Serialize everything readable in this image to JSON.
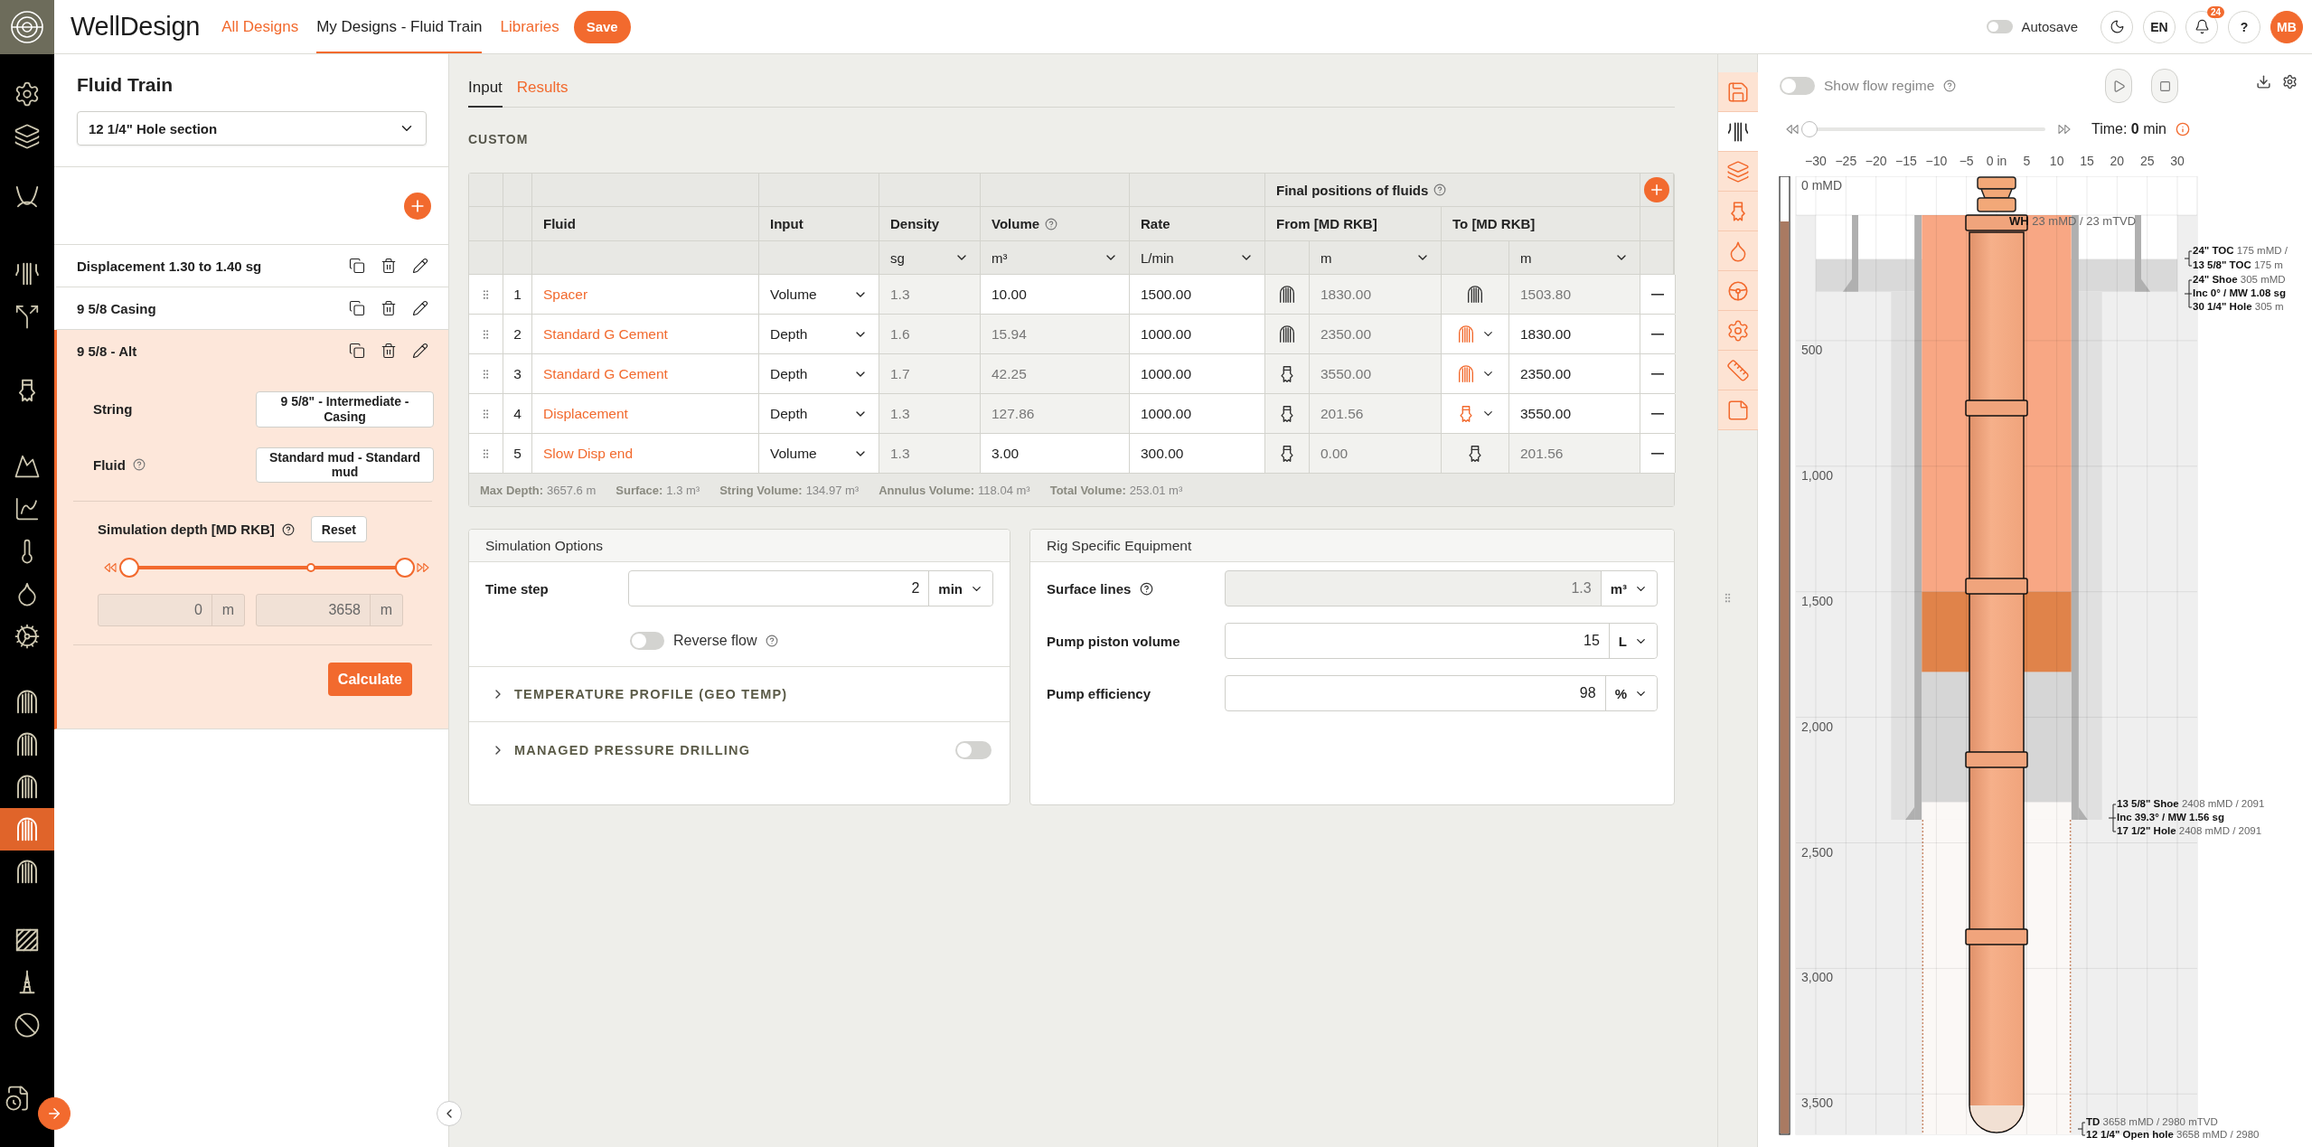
{
  "topbar": {
    "brand": "WellDesign",
    "nav": [
      {
        "label": "All Designs",
        "selected": false
      },
      {
        "label": "My Designs - Fluid Train",
        "selected": true
      },
      {
        "label": "Libraries",
        "selected": false
      }
    ],
    "save": "Save",
    "autosave": {
      "label": "Autosave",
      "on": false
    },
    "language": "EN",
    "notifications": "24",
    "help": "?",
    "avatar": "MB"
  },
  "rail": {
    "groups": [
      {
        "items": [
          {
            "kind": "gear",
            "selected": false
          },
          {
            "kind": "strata",
            "selected": false
          }
        ]
      },
      {
        "items": [
          {
            "kind": "curve",
            "selected": false
          }
        ]
      },
      {
        "items": [
          {
            "kind": "pipes",
            "selected": false
          },
          {
            "kind": "split",
            "selected": false
          }
        ]
      },
      {
        "items": [
          {
            "kind": "bit",
            "selected": false
          }
        ]
      },
      {
        "items": [
          {
            "kind": "mountains",
            "selected": false
          },
          {
            "kind": "chart",
            "selected": false
          },
          {
            "kind": "thermometer",
            "selected": false
          },
          {
            "kind": "droplet",
            "selected": false
          },
          {
            "kind": "gear-play",
            "selected": false
          }
        ]
      },
      {
        "items": [
          {
            "kind": "casing",
            "selected": false
          },
          {
            "kind": "casing",
            "selected": false
          },
          {
            "kind": "casing",
            "selected": false
          },
          {
            "kind": "casing",
            "selected": true
          },
          {
            "kind": "casing",
            "selected": false
          }
        ]
      },
      {
        "items": [
          {
            "kind": "hatch",
            "selected": false
          },
          {
            "kind": "tower",
            "selected": false
          },
          {
            "kind": "ban",
            "selected": false
          }
        ]
      },
      {
        "items": [
          {
            "kind": "file-clock",
            "selected": false
          }
        ]
      }
    ]
  },
  "sidebar": {
    "title": "Fluid Train",
    "section": "12 1/4\" Hole section",
    "trains": [
      {
        "name": "Displacement 1.30 to 1.40 sg",
        "selected": false
      },
      {
        "name": "9 5/8 Casing",
        "selected": false
      },
      {
        "name": "9 5/8 - Alt",
        "selected": true,
        "details": {
          "string_label": "String",
          "string_value": "9 5/8\" - Intermediate - Casing",
          "fluid_label": "Fluid",
          "fluid_value": "Standard mud - Standard mud",
          "depth_label": "Simulation depth [MD RKB]",
          "reset": "Reset",
          "range": {
            "start": {
              "level": 0
            },
            "marker": {
              "level": 0.66
            },
            "end": {
              "level": 1
            }
          },
          "from": {
            "value": "0",
            "unit": "m"
          },
          "to": {
            "value": "3658",
            "unit": "m"
          },
          "calculate": "Calculate"
        }
      }
    ]
  },
  "main": {
    "tabs": [
      {
        "label": "Input",
        "selected": true
      },
      {
        "label": "Results",
        "selected": false
      }
    ],
    "section": "CUSTOM",
    "table": {
      "group_header": "Final positions of fluids",
      "columns": [
        {
          "label": "Fluid",
          "help": false
        },
        {
          "label": "Input",
          "help": false
        },
        {
          "label": "Density",
          "help": false
        },
        {
          "label": "Volume",
          "help": true
        },
        {
          "label": "Rate",
          "help": false
        },
        {
          "label": "From [MD RKB]",
          "help": false
        },
        {
          "label": "To [MD RKB]",
          "help": false
        }
      ],
      "units": {
        "density": "sg",
        "volume": "m³",
        "rate": "L/min",
        "from": "m",
        "to": "m"
      },
      "rows": [
        {
          "index": "1",
          "fluid": "Spacer",
          "input": "Volume",
          "density": {
            "value": "1.3",
            "editable": false
          },
          "volume": {
            "value": "10.00",
            "editable": true
          },
          "rate": {
            "value": "1500.00",
            "editable": true
          },
          "from": {
            "kind": "casing",
            "value": "1830.00",
            "editable": false
          },
          "to": {
            "kind": "casing",
            "selectable": false,
            "value": "1503.80",
            "editable": false
          }
        },
        {
          "index": "2",
          "fluid": "Standard G Cement",
          "input": "Depth",
          "density": {
            "value": "1.6",
            "editable": false
          },
          "volume": {
            "value": "15.94",
            "editable": false
          },
          "rate": {
            "value": "1000.00",
            "editable": true
          },
          "from": {
            "kind": "casing",
            "value": "2350.00",
            "editable": false
          },
          "to": {
            "kind": "casing",
            "selectable": true,
            "value": "1830.00",
            "editable": true
          }
        },
        {
          "index": "3",
          "fluid": "Standard G Cement",
          "input": "Depth",
          "density": {
            "value": "1.7",
            "editable": false
          },
          "volume": {
            "value": "42.25",
            "editable": false
          },
          "rate": {
            "value": "1000.00",
            "editable": true
          },
          "from": {
            "kind": "bit",
            "value": "3550.00",
            "editable": false
          },
          "to": {
            "kind": "casing",
            "selectable": true,
            "value": "2350.00",
            "editable": true
          }
        },
        {
          "index": "4",
          "fluid": "Displacement",
          "input": "Depth",
          "density": {
            "value": "1.3",
            "editable": false
          },
          "volume": {
            "value": "127.86",
            "editable": false
          },
          "rate": {
            "value": "1000.00",
            "editable": true
          },
          "from": {
            "kind": "bit",
            "value": "201.56",
            "editable": false
          },
          "to": {
            "kind": "bit",
            "selectable": true,
            "value": "3550.00",
            "editable": true
          }
        },
        {
          "index": "5",
          "fluid": "Slow Disp end",
          "input": "Volume",
          "density": {
            "value": "1.3",
            "editable": false
          },
          "volume": {
            "value": "3.00",
            "editable": true
          },
          "rate": {
            "value": "300.00",
            "editable": true
          },
          "from": {
            "kind": "bit",
            "value": "0.00",
            "editable": false
          },
          "to": {
            "kind": "bit",
            "selectable": false,
            "value": "201.56",
            "editable": false
          }
        }
      ],
      "totals": [
        {
          "label": "Max Depth:",
          "value": "3657.6 m"
        },
        {
          "label": "Surface:",
          "value": "1.3 m³"
        },
        {
          "label": "String Volume:",
          "value": "134.97 m³"
        },
        {
          "label": "Annulus Volume:",
          "value": "118.04 m³"
        },
        {
          "label": "Total Volume:",
          "value": "253.01 m³"
        }
      ]
    },
    "simulation": {
      "title": "Simulation Options",
      "time_step": {
        "label": "Time step",
        "value": "2",
        "unit": "min"
      },
      "reverse_flow": {
        "label": "Reverse flow",
        "on": false
      },
      "sections": [
        {
          "kind": "plain",
          "label": "TEMPERATURE PROFILE (GEO TEMP)",
          "expanded": false
        },
        {
          "kind": "toggle",
          "label": "MANAGED PRESSURE DRILLING",
          "expanded": false,
          "on": false
        }
      ]
    },
    "rig": {
      "title": "Rig Specific Equipment",
      "fields": [
        {
          "label": "Surface lines",
          "help": true,
          "value": "1.3",
          "unit": "m³",
          "disabled": true
        },
        {
          "label": "Pump piston volume",
          "help": false,
          "value": "15",
          "unit": "L",
          "disabled": false
        },
        {
          "label": "Pump efficiency",
          "help": false,
          "value": "98",
          "unit": "%",
          "disabled": false
        }
      ]
    }
  },
  "side_tabs": [
    {
      "kind": "save",
      "selected": false
    },
    {
      "kind": "pipes",
      "selected": true
    },
    {
      "kind": "strata",
      "selected": false
    },
    {
      "kind": "bit",
      "selected": false
    },
    {
      "kind": "droplet",
      "selected": false
    },
    {
      "kind": "wheel",
      "selected": false
    },
    {
      "kind": "gear",
      "selected": false
    },
    {
      "kind": "ruler",
      "selected": false
    },
    {
      "kind": "note",
      "selected": false
    }
  ],
  "wellbore": {
    "flow_regime": {
      "label": "Show flow regime",
      "on": false
    },
    "time_slider": {
      "level": 0
    },
    "time": "Time: **0** min",
    "x_ticks": [
      "−30",
      "−25",
      "−20",
      "−15",
      "−10",
      "−5",
      "0 in",
      "5",
      "10",
      "15",
      "20",
      "25",
      "30"
    ],
    "depth_labels": [
      "0 mMD",
      "500",
      "1,000",
      "1,500",
      "2,000",
      "2,500",
      "3,000",
      "3,500"
    ],
    "wellhead": {
      "title": "WH",
      "detail": "23 mMD / 23 mTVD"
    },
    "annotations": [
      {
        "lines": [
          {
            "title": "24\" TOC",
            "detail": "175 mMD /"
          },
          {
            "title": "13 5/8\" TOC",
            "detail": "175 m"
          }
        ]
      },
      {
        "lines": [
          {
            "title": "24\" Shoe",
            "detail": "305 mMD"
          },
          {
            "title": "Inc 0° / MW 1.08 sg"
          },
          {
            "title": "30 1/4\" Hole",
            "detail": "305 m"
          }
        ]
      },
      {
        "lines": [
          {
            "title": "13 5/8\" Shoe",
            "detail": "2408 mMD / 2091"
          },
          {
            "title": "Inc 39.3° / MW 1.56 sg"
          },
          {
            "title": "17 1/2\" Hole",
            "detail": "2408 mMD / 2091"
          }
        ]
      },
      {
        "lines": [
          {
            "title": "TD",
            "detail": "3658 mMD / 2980 mTVD"
          },
          {
            "title": "12 1/4\" Open hole",
            "detail": "3658 mMD / 2980"
          }
        ]
      }
    ]
  }
}
